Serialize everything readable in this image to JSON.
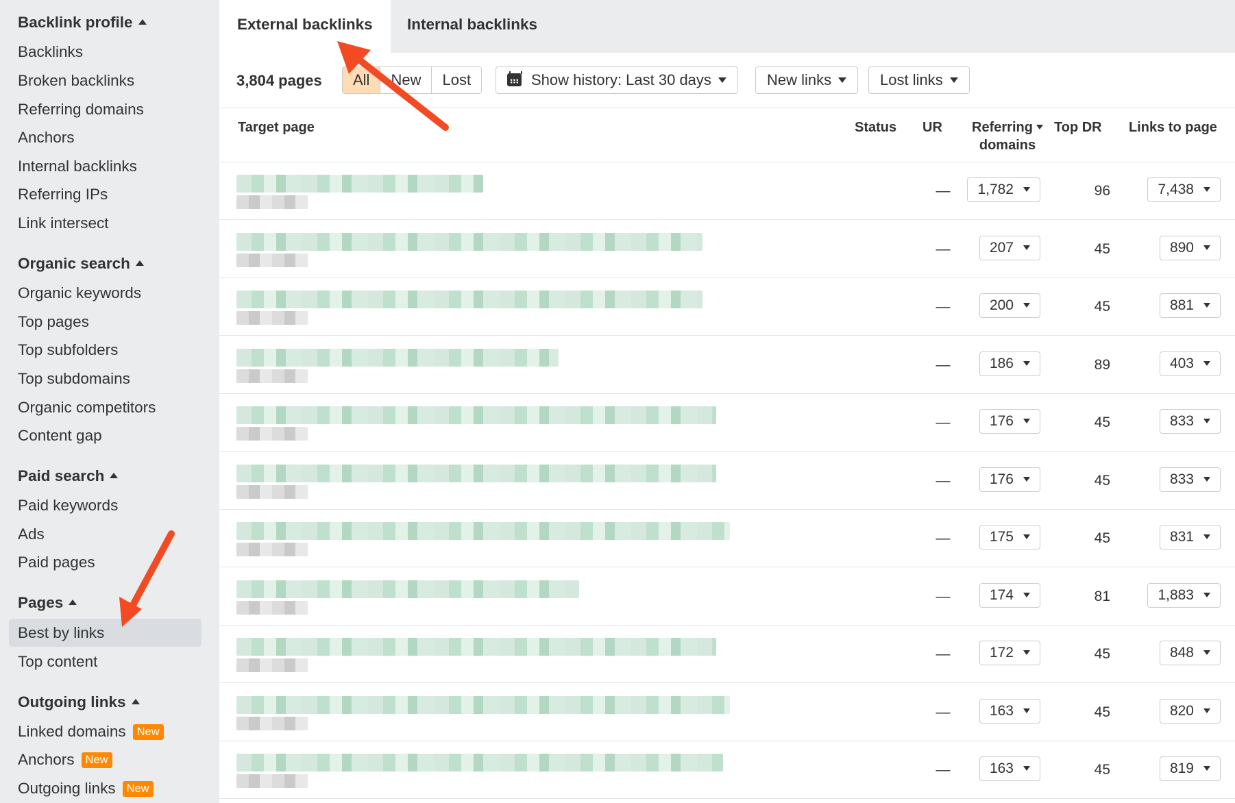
{
  "sidebar": {
    "groups": [
      {
        "title": "Backlink profile",
        "items": [
          {
            "label": "Backlinks"
          },
          {
            "label": "Broken backlinks"
          },
          {
            "label": "Referring domains"
          },
          {
            "label": "Anchors"
          },
          {
            "label": "Internal backlinks"
          },
          {
            "label": "Referring IPs"
          },
          {
            "label": "Link intersect"
          }
        ]
      },
      {
        "title": "Organic search",
        "items": [
          {
            "label": "Organic keywords"
          },
          {
            "label": "Top pages"
          },
          {
            "label": "Top subfolders"
          },
          {
            "label": "Top subdomains"
          },
          {
            "label": "Organic competitors"
          },
          {
            "label": "Content gap"
          }
        ]
      },
      {
        "title": "Paid search",
        "items": [
          {
            "label": "Paid keywords"
          },
          {
            "label": "Ads"
          },
          {
            "label": "Paid pages"
          }
        ]
      },
      {
        "title": "Pages",
        "items": [
          {
            "label": "Best by links",
            "active": true
          },
          {
            "label": "Top content"
          }
        ]
      },
      {
        "title": "Outgoing links",
        "items": [
          {
            "label": "Linked domains",
            "badge": "New"
          },
          {
            "label": "Anchors",
            "badge": "New"
          },
          {
            "label": "Outgoing links",
            "badge": "New"
          }
        ]
      }
    ]
  },
  "tabs": [
    {
      "label": "External backlinks",
      "active": true
    },
    {
      "label": "Internal backlinks",
      "active": false
    }
  ],
  "toolbar": {
    "count": "3,804 pages",
    "filter": [
      {
        "label": "All",
        "active": true
      },
      {
        "label": "New",
        "active": false
      },
      {
        "label": "Lost",
        "active": false
      }
    ],
    "history": "Show history: Last 30 days",
    "new_links": "New links",
    "lost_links": "Lost links"
  },
  "table": {
    "columns": {
      "target": "Target page",
      "status": "Status",
      "ur": "UR",
      "referring_1": "Referring",
      "referring_2": "domains",
      "top_dr": "Top DR",
      "links": "Links to page"
    },
    "rows": [
      {
        "ur": "—",
        "referring_domains": "1,782",
        "top_dr": "96",
        "links_to_page": "7,438"
      },
      {
        "ur": "—",
        "referring_domains": "207",
        "top_dr": "45",
        "links_to_page": "890"
      },
      {
        "ur": "—",
        "referring_domains": "200",
        "top_dr": "45",
        "links_to_page": "881"
      },
      {
        "ur": "—",
        "referring_domains": "186",
        "top_dr": "89",
        "links_to_page": "403"
      },
      {
        "ur": "—",
        "referring_domains": "176",
        "top_dr": "45",
        "links_to_page": "833"
      },
      {
        "ur": "—",
        "referring_domains": "176",
        "top_dr": "45",
        "links_to_page": "833"
      },
      {
        "ur": "—",
        "referring_domains": "175",
        "top_dr": "45",
        "links_to_page": "831"
      },
      {
        "ur": "—",
        "referring_domains": "174",
        "top_dr": "81",
        "links_to_page": "1,883"
      },
      {
        "ur": "—",
        "referring_domains": "172",
        "top_dr": "45",
        "links_to_page": "848"
      },
      {
        "ur": "—",
        "referring_domains": "163",
        "top_dr": "45",
        "links_to_page": "820"
      },
      {
        "ur": "—",
        "referring_domains": "163",
        "top_dr": "45",
        "links_to_page": "819"
      }
    ]
  },
  "colors": {
    "accent_orange": "#ff8800",
    "annotation_arrow": "#f24b23",
    "active_filter": "#fddcb6",
    "sidebar_bg": "#ebecee"
  }
}
